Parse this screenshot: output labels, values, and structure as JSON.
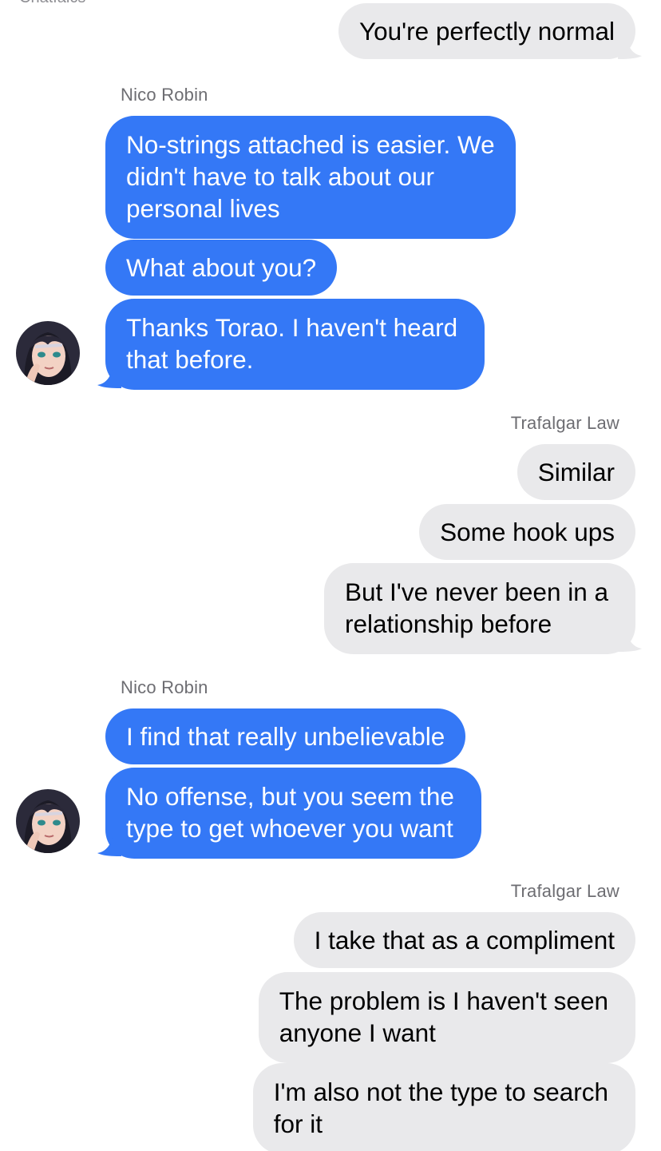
{
  "header": {
    "clipped_text": "Chatfalcs"
  },
  "messages": [
    {
      "side": "out",
      "text": "You're perfectly normal"
    },
    {
      "side": "in",
      "sender": "Nico Robin",
      "text": "No-strings attached is easier. We\ndidn't have to talk about our\npersonal lives"
    },
    {
      "side": "in",
      "text": "What about you?"
    },
    {
      "side": "in",
      "text": "Thanks Torao. I haven't heard\nthat before."
    },
    {
      "side": "out",
      "sender": "Trafalgar Law",
      "text": "Similar"
    },
    {
      "side": "out",
      "text": "Some hook ups"
    },
    {
      "side": "out",
      "text": "But I've never been in a\nrelationship before"
    },
    {
      "side": "in",
      "sender": "Nico Robin",
      "text": "I find that really unbelievable"
    },
    {
      "side": "in",
      "text": "No offense, but you seem the\ntype to get whoever you want"
    },
    {
      "side": "out",
      "sender": "Trafalgar Law",
      "text": "I take that as a compliment"
    },
    {
      "side": "out",
      "text": "The problem is I haven't seen\nanyone I want"
    },
    {
      "side": "out",
      "text": "I'm also not the type to search\nfor it"
    }
  ],
  "colors": {
    "incoming_bubble": "#3478f6",
    "outgoing_bubble": "#e9e9eb",
    "sender_label": "#6d6d72"
  },
  "avatar": {
    "icon": "nico-robin-avatar-icon"
  }
}
